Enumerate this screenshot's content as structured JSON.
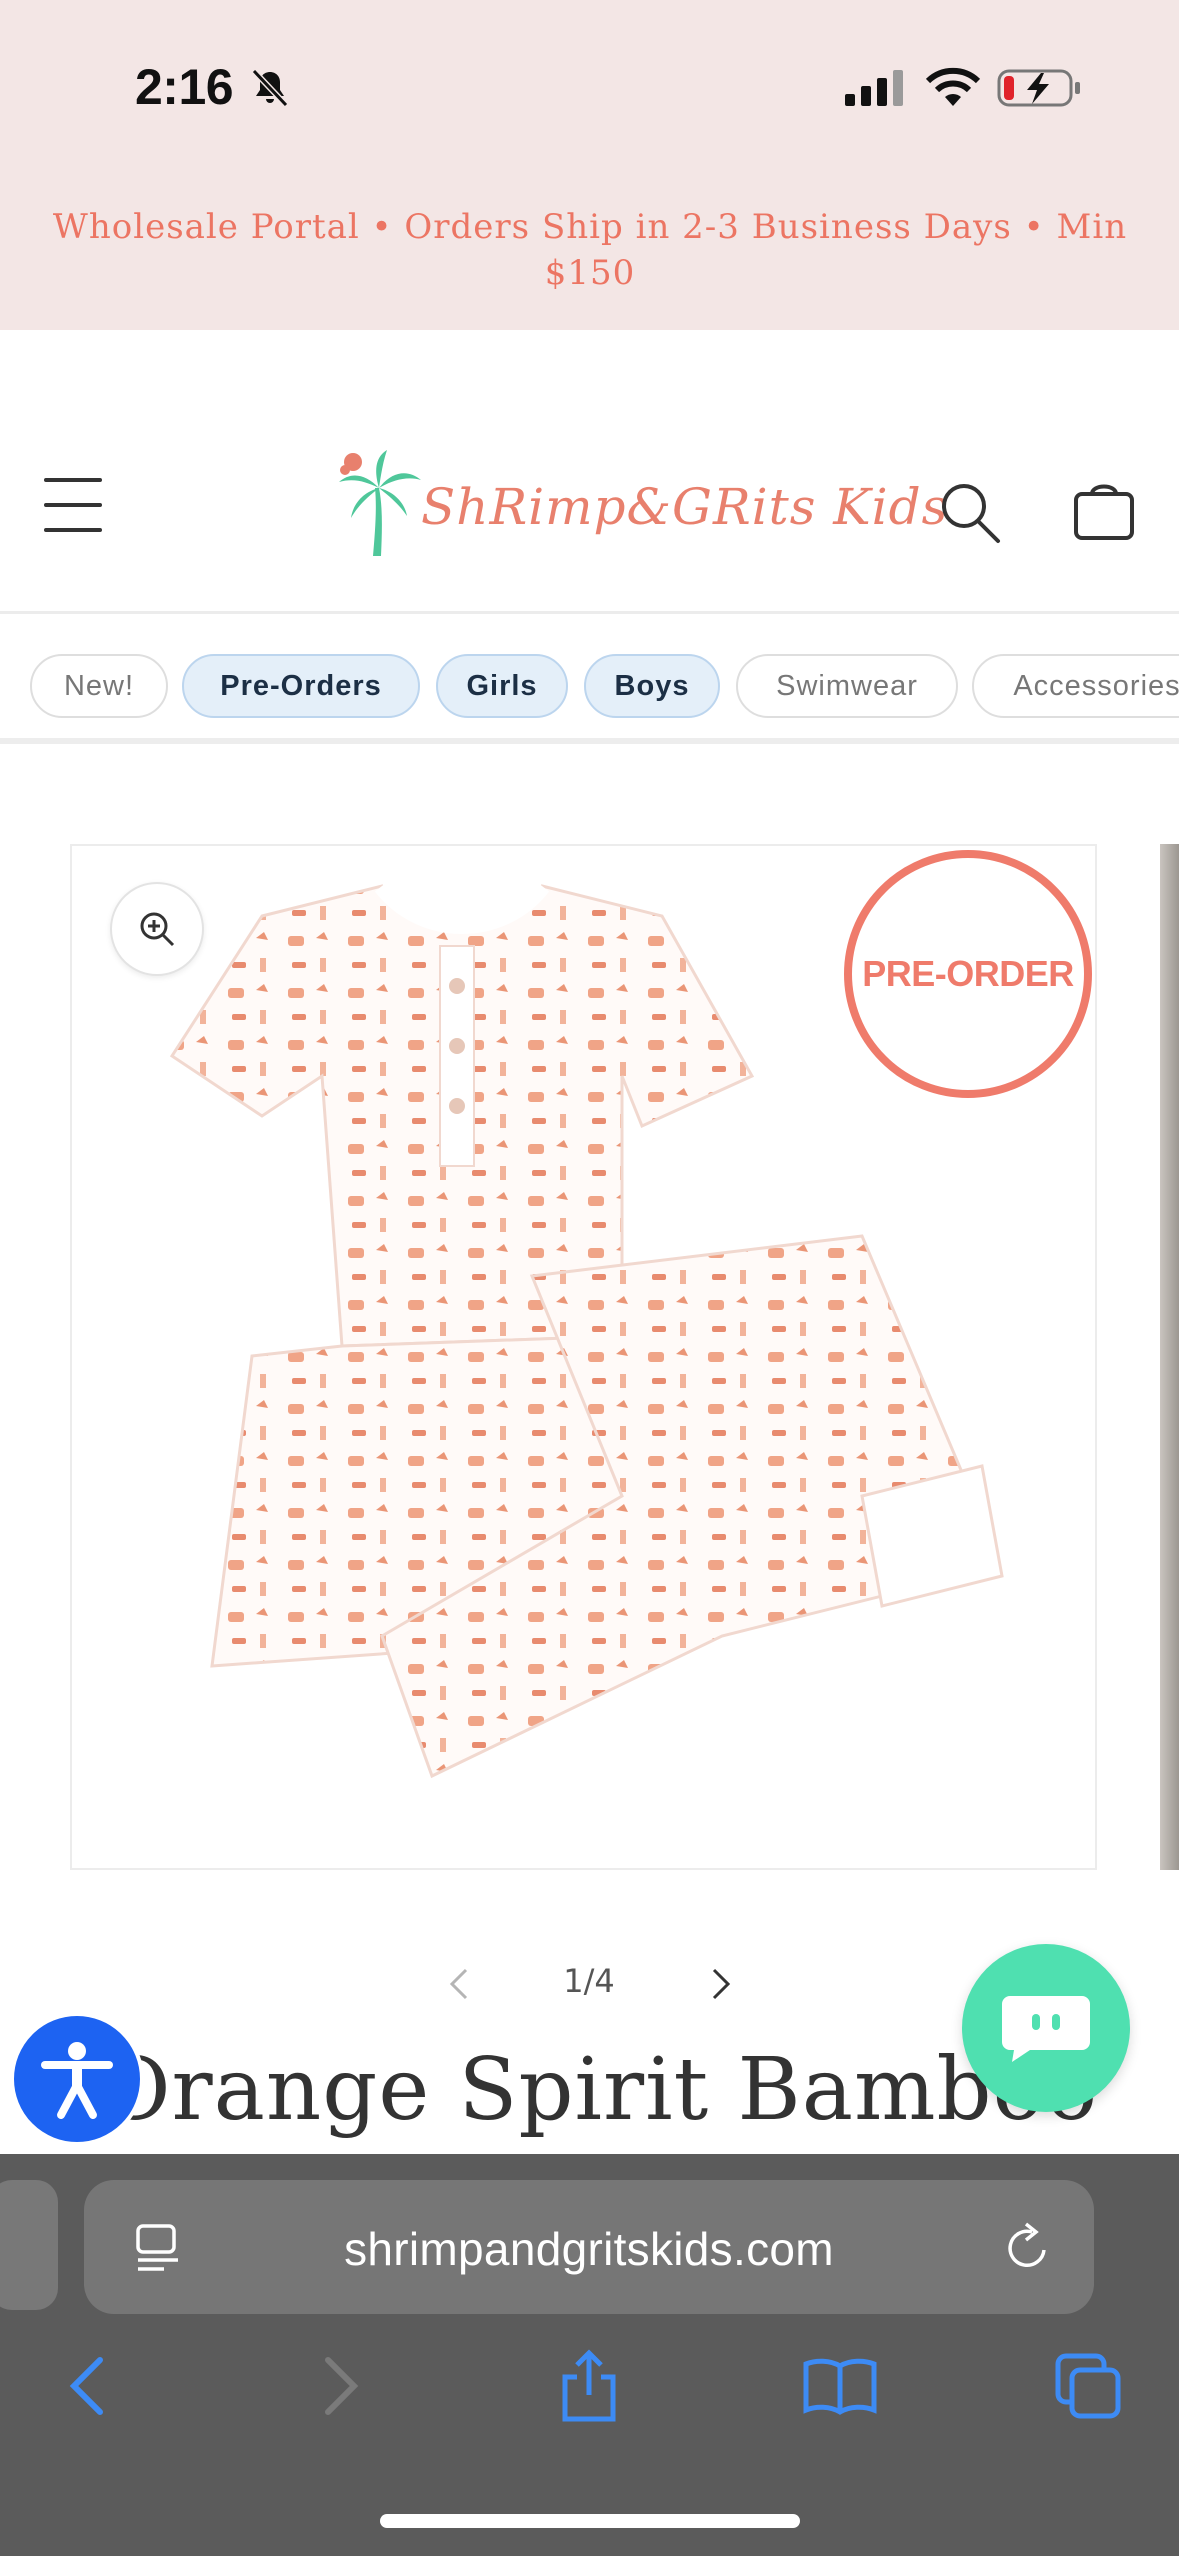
{
  "status_bar": {
    "time": "2:16"
  },
  "announcement": {
    "text": "Wholesale Portal • Orders Ship in 2-3 Business Days • Min $150"
  },
  "header": {
    "logo_text": "ShRimp&GRits Kids"
  },
  "categories": [
    {
      "label": "New!",
      "active": false
    },
    {
      "label": "Pre-Orders",
      "active": true
    },
    {
      "label": "Girls",
      "active": true
    },
    {
      "label": "Boys",
      "active": true
    },
    {
      "label": "Swimwear",
      "active": false
    },
    {
      "label": "Accessories",
      "active": false
    }
  ],
  "product": {
    "badge": "PRE-ORDER",
    "title": "Orange Spirit Bamboo",
    "pager": "1/4"
  },
  "browser": {
    "url": "shrimpandgritskids.com"
  },
  "colors": {
    "accent_coral": "#ef7b6b",
    "chip_active_bg": "#e4eff9",
    "chat_button": "#4fe0b0",
    "accessibility_button": "#1d63f2",
    "safari_toolbar": "#5b5b5b",
    "safari_link_blue": "#3d8bf5"
  }
}
